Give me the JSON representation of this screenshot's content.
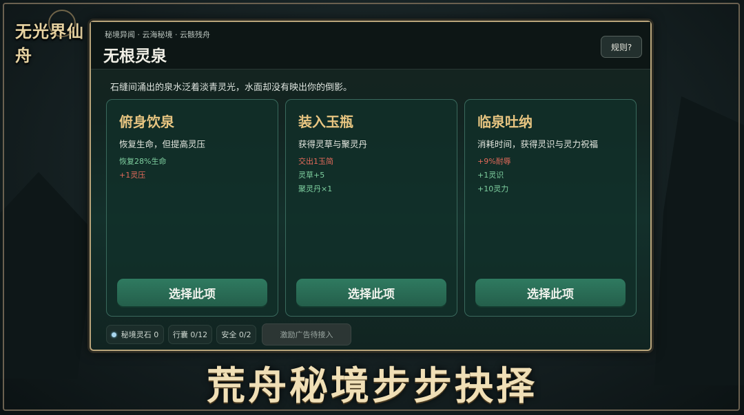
{
  "logo": {
    "text": "无光界仙舟"
  },
  "panel": {
    "breadcrumb": "秘境异闻 · 云海秘境 · 云骸残舟",
    "title": "无根灵泉",
    "rules_button": "规则?",
    "description": "石缝间涌出的泉水泛着淡青灵光，水面却没有映出你的倒影。"
  },
  "options": [
    {
      "title": "俯身饮泉",
      "subtitle": "恢复生命，但提高灵压",
      "effects": [
        {
          "text": "恢复28%生命",
          "type": "positive"
        },
        {
          "text": "+1灵压",
          "type": "negative"
        }
      ],
      "button": "选择此项"
    },
    {
      "title": "装入玉瓶",
      "subtitle": "获得灵草与聚灵丹",
      "effects": [
        {
          "text": "交出1玉简",
          "type": "negative"
        },
        {
          "text": "灵草+5",
          "type": "positive"
        },
        {
          "text": "聚灵丹×1",
          "type": "positive"
        }
      ],
      "button": "选择此项"
    },
    {
      "title": "临泉吐纳",
      "subtitle": "消耗时间，获得灵识与灵力祝福",
      "effects": [
        {
          "text": "+9%耐辱",
          "type": "negative"
        },
        {
          "text": "+1灵识",
          "type": "positive"
        },
        {
          "text": "+10灵力",
          "type": "positive"
        }
      ],
      "button": "选择此项"
    }
  ],
  "footer": {
    "spirit_stones": "秘境灵石 0",
    "bag": "行囊 0/12",
    "safety": "安全 0/2",
    "ad_button": "激励广告待接入"
  },
  "banner": "荒舟秘境步步抉择",
  "colors": {
    "accent_gold": "#e8c581",
    "positive": "#7fd0a0",
    "negative": "#e36a5a",
    "button_green": "#2f7a60"
  }
}
